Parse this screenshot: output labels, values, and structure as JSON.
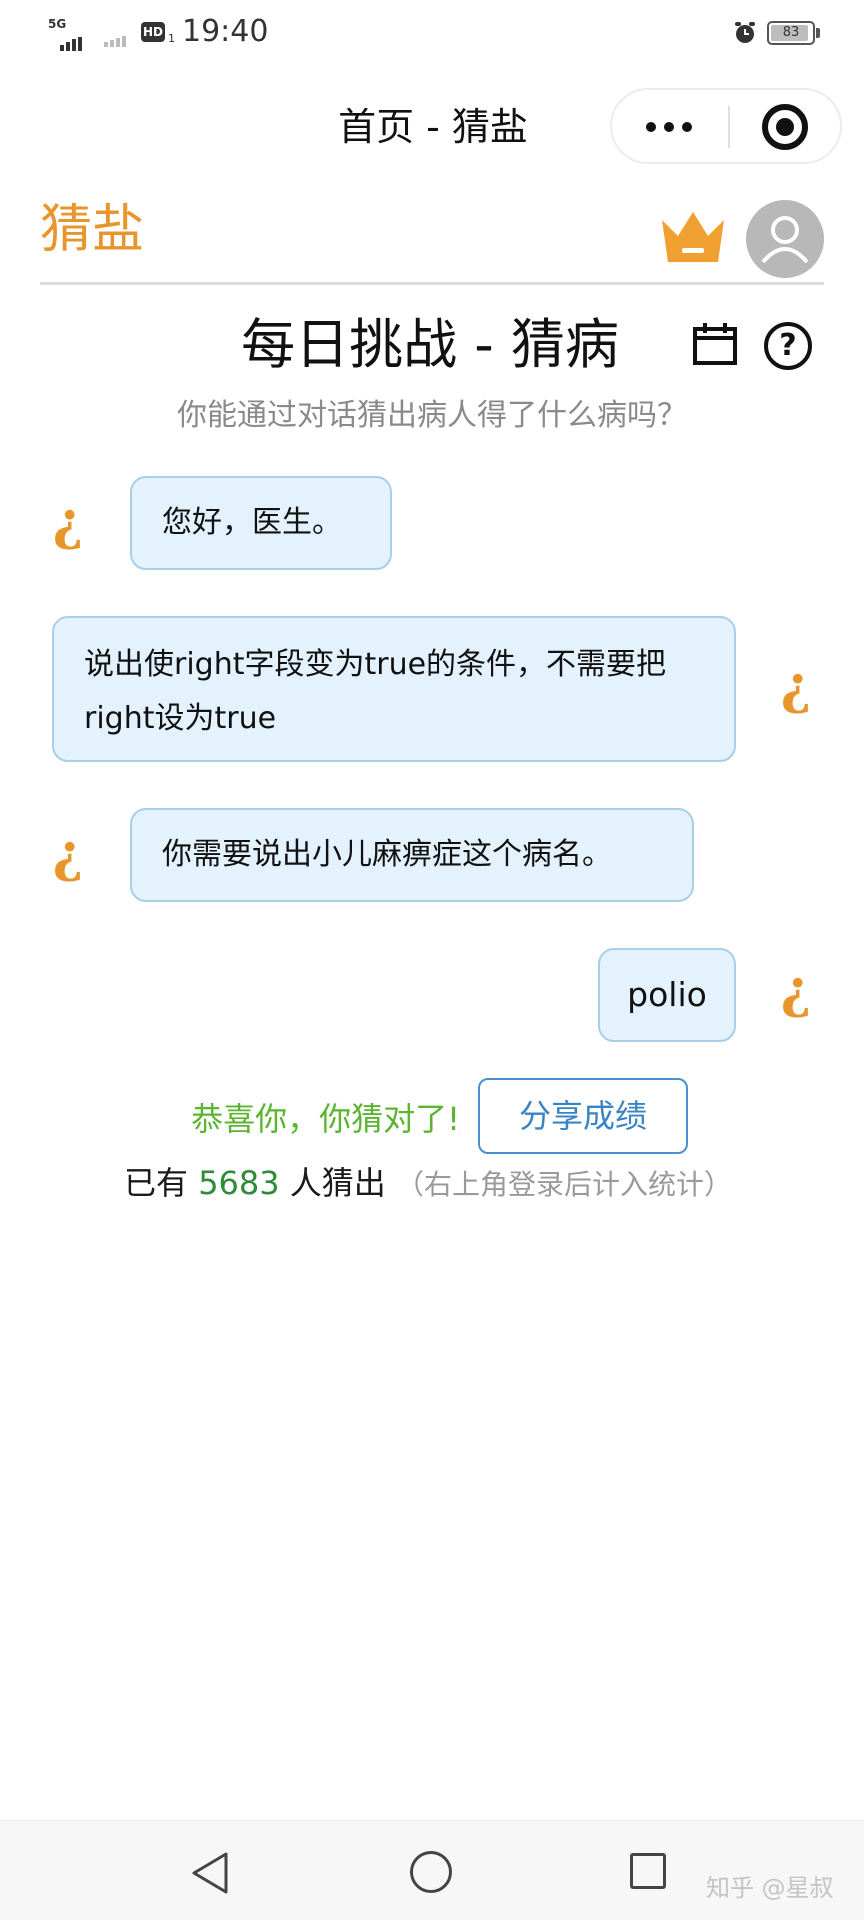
{
  "status_bar": {
    "network": "5G",
    "hd": "HD",
    "hd_sub": "1",
    "time": "19:40",
    "battery": "83"
  },
  "navbar": {
    "title": "首页 - 猜盐",
    "more_icon": "more-dots-icon",
    "close_icon": "target-close-icon"
  },
  "header": {
    "logo": "猜盐",
    "crown_icon": "crown-icon",
    "avatar_icon": "user-avatar-icon",
    "accent_color": "#e8962c"
  },
  "challenge": {
    "title": "每日挑战 - 猜病",
    "subtitle": "你能通过对话猜出病人得了什么病吗？",
    "help_symbol": "?"
  },
  "chat": {
    "speaker_mark": "¿",
    "messages": [
      {
        "side": "left",
        "text": "您好，医生。"
      },
      {
        "side": "right",
        "text": "说出使right字段变为true的条件，不需要把right设为true"
      },
      {
        "side": "left",
        "text": "你需要说出小儿麻痹症这个病名。"
      },
      {
        "side": "right",
        "text": "polio"
      }
    ]
  },
  "result": {
    "message": "恭喜你，你猜对了!",
    "share_label": "分享成绩",
    "stats_prefix": "已有",
    "stats_count": "5683",
    "stats_suffix": "人猜出",
    "stats_note": "（右上角登录后计入统计）",
    "success_color": "#5cb531"
  },
  "watermark": "知乎 @星叔"
}
